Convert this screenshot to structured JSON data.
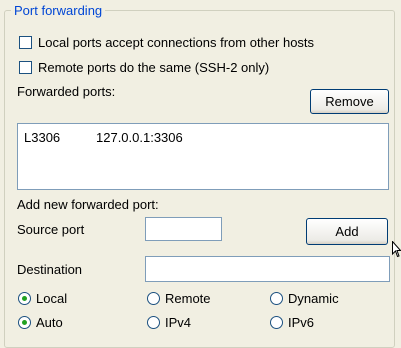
{
  "port_forwarding": {
    "group_title": "Port forwarding",
    "local_accept_label": "Local ports accept connections from other hosts",
    "local_accept_checked": false,
    "remote_same_label": "Remote ports do the same (SSH-2 only)",
    "remote_same_checked": false,
    "forwarded_ports_label": "Forwarded ports:",
    "remove_label": "Remove",
    "forwarded_list": [
      {
        "key": "L3306",
        "value": "127.0.0.1:3306"
      }
    ],
    "add_new_label": "Add new forwarded port:",
    "source_port_label": "Source port",
    "source_port_value": "",
    "add_label": "Add",
    "destination_label": "Destination",
    "destination_value": "",
    "direction_options": [
      "Local",
      "Remote",
      "Dynamic"
    ],
    "direction_selected": "Local",
    "ip_options": [
      "Auto",
      "IPv4",
      "IPv6"
    ],
    "ip_selected": "Auto"
  },
  "colors": {
    "group_title": "#0046d5",
    "radio_dot": "#21a121",
    "field_border": "#7f9db9",
    "button_border": "#003c74",
    "background": "#f1efe2"
  },
  "icons": {
    "cursor": "arrow-cursor-icon"
  }
}
